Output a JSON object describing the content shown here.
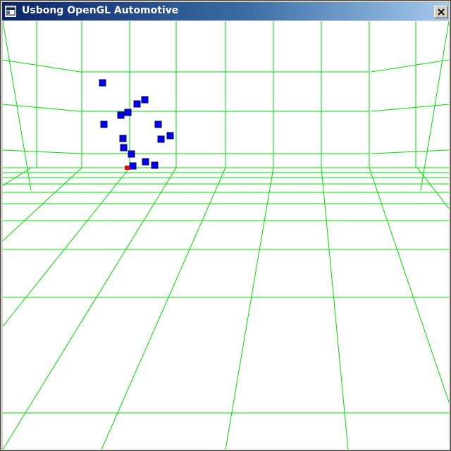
{
  "window": {
    "title": "Usbong OpenGL Automotive",
    "app_icon": "window-app-icon",
    "close_icon": "close-icon"
  },
  "viewport": {
    "background": "#ffffff",
    "grid_color": "#00dd00",
    "cube_color": "#0000ee",
    "cube_edge_color": "#000066",
    "marker_color": "#ee0000"
  }
}
